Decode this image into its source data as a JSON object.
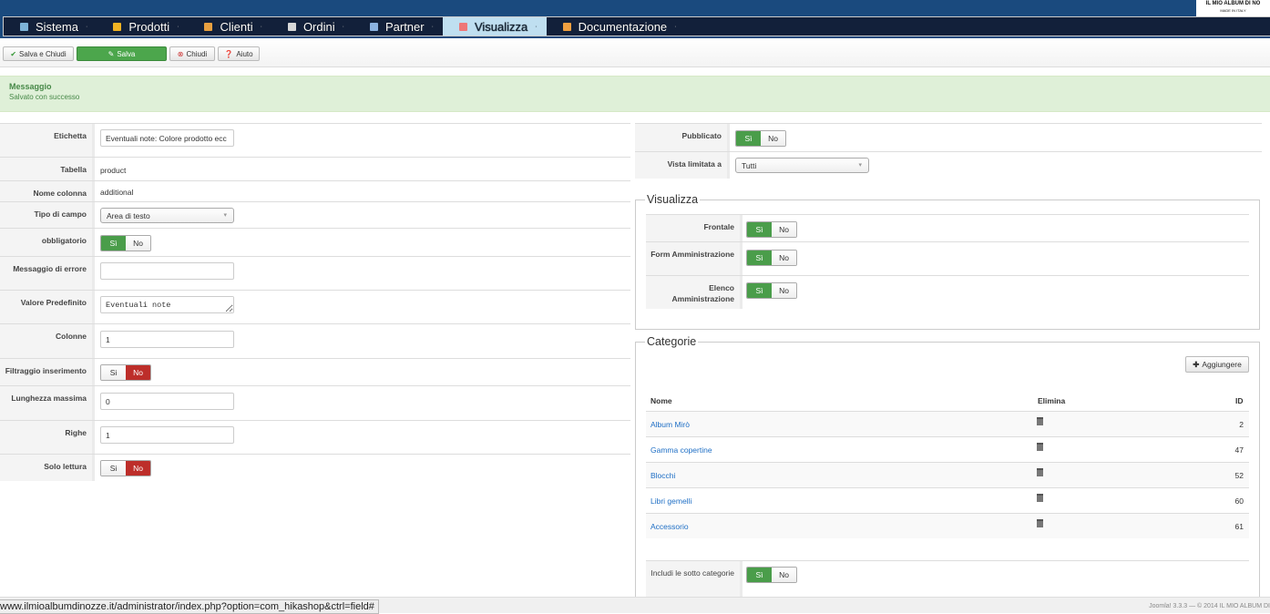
{
  "logo": {
    "line1": "IL MIO ALBUM DI NO",
    "line2": "MADE IN ITALY"
  },
  "menu": [
    {
      "label": "Sistema",
      "icon": "tools-icon",
      "color": "#7db3d8"
    },
    {
      "label": "Prodotti",
      "icon": "box-icon",
      "color": "#f0b323"
    },
    {
      "label": "Clienti",
      "icon": "users-icon",
      "color": "#e8a040"
    },
    {
      "label": "Ordini",
      "icon": "document-icon",
      "color": "#d8d8d8"
    },
    {
      "label": "Partner",
      "icon": "partner-icon",
      "color": "#8bb2e0"
    },
    {
      "label": "Visualizza",
      "icon": "display-icon",
      "color": "#e77",
      "active": true
    },
    {
      "label": "Documentazione",
      "icon": "help-ring-icon",
      "color": "#f0a040"
    }
  ],
  "toolbar": {
    "save_close": "Salva e Chiudi",
    "save": "Salva",
    "close": "Chiudi",
    "help": "Aiuto"
  },
  "message": {
    "title": "Messaggio",
    "text": "Salvato con successo"
  },
  "form": {
    "etichetta": {
      "label": "Etichetta",
      "value": "Eventuali note: Colore prodotto ecc"
    },
    "tabella": {
      "label": "Tabella",
      "value": "product"
    },
    "nome_colonna": {
      "label": "Nome colonna",
      "value": "additional"
    },
    "tipo": {
      "label": "Tipo di campo",
      "value": "Area di testo"
    },
    "obbligatorio": {
      "label": "obbligatorio",
      "yes": "Sì",
      "no": "No"
    },
    "errore": {
      "label": "Messaggio di errore",
      "value": ""
    },
    "predefinito": {
      "label": "Valore Predefinito",
      "value": "Eventuali note"
    },
    "colonne": {
      "label": "Colonne",
      "value": "1"
    },
    "filtraggio": {
      "label": "Filtraggio inserimento",
      "yes": "Si",
      "no": "No"
    },
    "lunghezza": {
      "label": "Lunghezza massima",
      "value": "0"
    },
    "righe": {
      "label": "Righe",
      "value": "1"
    },
    "solo_lettura": {
      "label": "Solo lettura",
      "yes": "Si",
      "no": "No"
    }
  },
  "right": {
    "pubblicato": {
      "label": "Pubblicato",
      "yes": "Sì",
      "no": "No"
    },
    "vista": {
      "label": "Vista limitata a",
      "value": "Tutti"
    },
    "visualizza": {
      "legend": "Visualizza",
      "frontale": "Frontale",
      "form_admin": "Form Amministrazione",
      "elenco_admin": "Elenco Amministrazione",
      "yes": "Sì",
      "no": "No"
    },
    "categorie": {
      "legend": "Categorie",
      "add": "Aggiungere",
      "col_nome": "Nome",
      "col_elimina": "Elimina",
      "col_id": "ID",
      "rows": [
        {
          "name": "Album Mirò",
          "id": "2"
        },
        {
          "name": "Gamma copertine",
          "id": "47"
        },
        {
          "name": "Blocchi",
          "id": "52"
        },
        {
          "name": "Libri gemelli",
          "id": "60"
        },
        {
          "name": "Accessorio",
          "id": "61"
        }
      ],
      "sub": {
        "label": "Includi le sotto categorie",
        "yes": "Sì",
        "no": "No"
      }
    }
  },
  "status": {
    "url": "www.ilmioalbumdinozze.it/administrator/index.php?option=com_hikashop&ctrl=field#",
    "footer": "Joomla! 3.3.3  —  © 2014 IL MIO ALBUM DI"
  }
}
